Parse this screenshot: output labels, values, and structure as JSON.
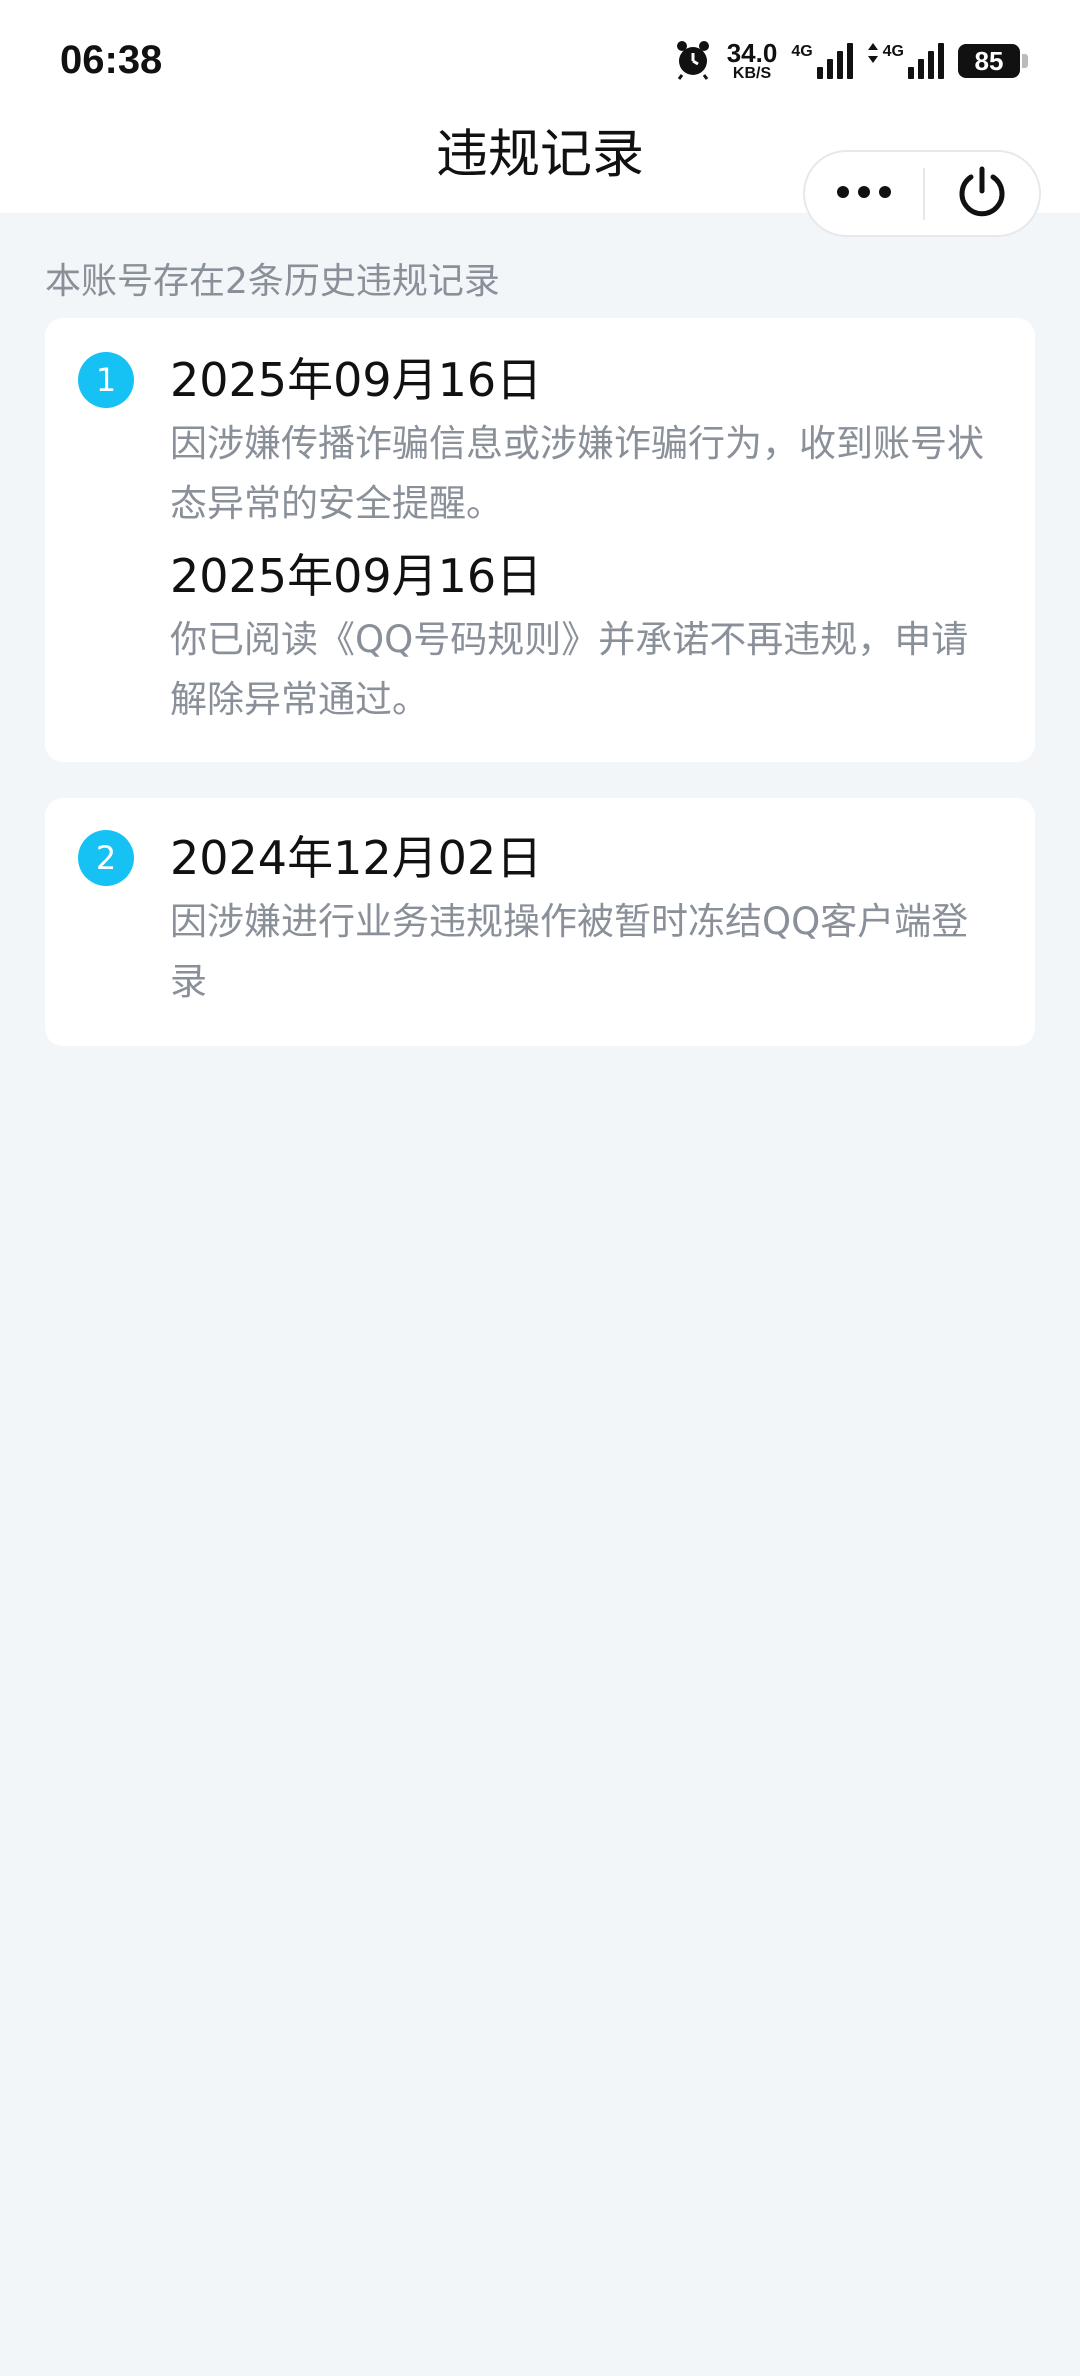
{
  "status_bar": {
    "time": "06:38",
    "speed_value": "34.0",
    "speed_unit": "KB/S",
    "network1": "4G",
    "network2": "4G",
    "battery": "85"
  },
  "header": {
    "title": "违规记录"
  },
  "summary": "本账号存在2条历史违规记录",
  "records": [
    {
      "index": "1",
      "entries": [
        {
          "date": "2025年09月16日",
          "description": "因涉嫌传播诈骗信息或涉嫌诈骗行为，收到账号状态异常的安全提醒。"
        },
        {
          "date": "2025年09月16日",
          "description": "你已阅读《QQ号码规则》并承诺不再违规，申请解除异常通过。"
        }
      ]
    },
    {
      "index": "2",
      "entries": [
        {
          "date": "2024年12月02日",
          "description": "因涉嫌进行业务违规操作被暂时冻结QQ客户端登录"
        }
      ]
    }
  ],
  "colors": {
    "accent": "#16c1f3",
    "background": "#f3f6f9",
    "secondary_text": "#8a9099"
  }
}
